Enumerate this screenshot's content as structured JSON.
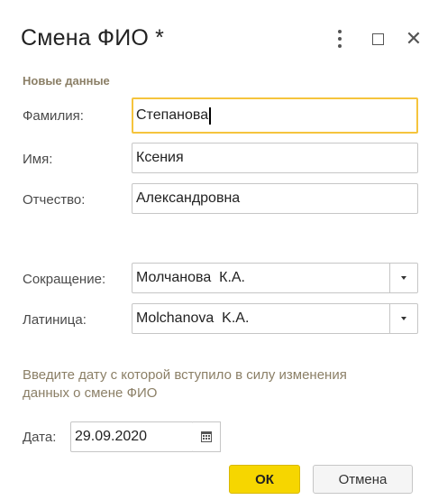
{
  "window": {
    "title": "Смена ФИО *"
  },
  "section": {
    "title": "Новые данные"
  },
  "fields": {
    "surname": {
      "label": "Фамилия:",
      "value": "Степанова"
    },
    "name": {
      "label": "Имя:",
      "value": "Ксения"
    },
    "patronymic": {
      "label": "Отчество:",
      "value": "Александровна"
    },
    "abbreviation": {
      "label": "Сокращение:",
      "value": "Молчанова  К.А."
    },
    "latin": {
      "label": "Латиница:",
      "value": "Molchanova  K.A."
    },
    "date": {
      "label": "Дата:",
      "value": "29.09.2020"
    }
  },
  "hint": "Введите дату с которой вступило в силу изменения данных о смене ФИО",
  "buttons": {
    "ok": "ОК",
    "cancel": "Отмена"
  },
  "colors": {
    "accent": "#f6d600",
    "focus_border": "#f5c43d",
    "section_text": "#8b7f66"
  },
  "icons": {
    "menu": "kebab-menu-icon",
    "maximize": "maximize-icon",
    "close": "close-icon",
    "dropdown": "chevron-down-icon",
    "calendar": "calendar-icon"
  }
}
